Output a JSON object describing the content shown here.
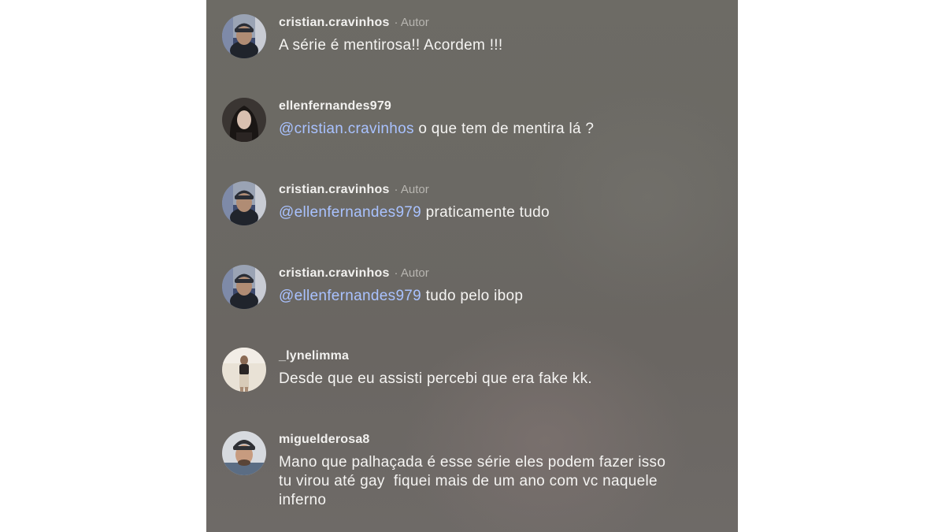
{
  "comments": [
    {
      "username": "cristian.cravinhos",
      "tag": "· Autor",
      "mention": "",
      "text": "A série é mentirosa!! Acordem !!!"
    },
    {
      "username": "ellenfernandes979",
      "tag": "",
      "mention": "@cristian.cravinhos",
      "text": " o que tem de mentira lá ?"
    },
    {
      "username": "cristian.cravinhos",
      "tag": "· Autor",
      "mention": "@ellenfernandes979",
      "text": " praticamente tudo"
    },
    {
      "username": "cristian.cravinhos",
      "tag": "· Autor",
      "mention": "@ellenfernandes979",
      "text": " tudo pelo ibop"
    },
    {
      "username": "_lynelimma",
      "tag": "",
      "mention": "",
      "text": "Desde que eu assisti percebi que era fake kk."
    },
    {
      "username": "miguelderosa8",
      "tag": "",
      "mention": "",
      "text_lines": [
        "Mano que palhaçada é esse série eles podem fazer isso",
        "tu virou até gay  fiquei mais de um ano com vc naquele",
        "inferno"
      ]
    }
  ],
  "colors": {
    "mention": "#a9c2ff",
    "username": "#f2f1ef",
    "author_tag": "#b8b6b1",
    "background": "#6b6964"
  },
  "icons": {
    "avatar_cristian": "profile-photo-man-cap",
    "avatar_ellen": "profile-photo-woman-dark-hair",
    "avatar_lyne": "profile-photo-woman-mirror",
    "avatar_miguel": "profile-photo-man-cap-white"
  }
}
